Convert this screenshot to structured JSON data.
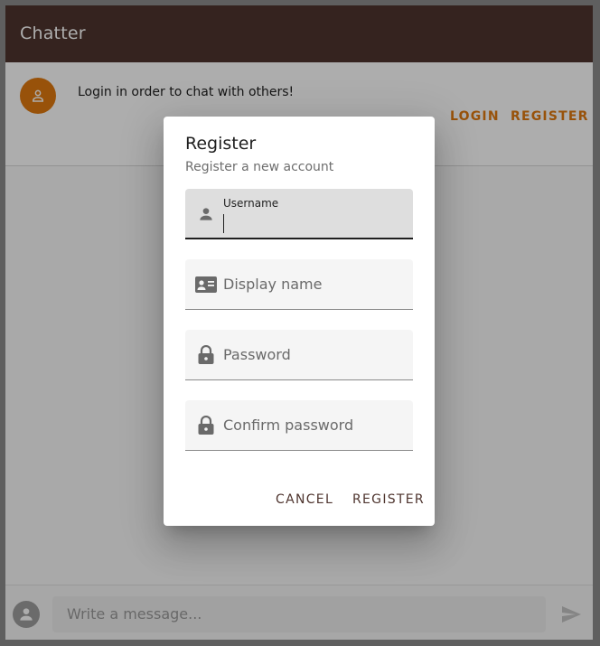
{
  "appbar": {
    "title": "Chatter"
  },
  "banner": {
    "message": "Login in order to chat with others!",
    "login_label": "LOGIN",
    "register_label": "REGISTER"
  },
  "composer": {
    "placeholder": "Write a message..."
  },
  "dialog": {
    "title": "Register",
    "subtitle": "Register a new account",
    "fields": [
      {
        "label": "Username",
        "icon": "person-icon",
        "active": true
      },
      {
        "label": "Display name",
        "icon": "id-card-icon"
      },
      {
        "label": "Password",
        "icon": "lock-icon"
      },
      {
        "label": "Confirm password",
        "icon": "lock-icon"
      }
    ],
    "cancel_label": "CANCEL",
    "register_label": "REGISTER"
  },
  "colors": {
    "appbar": "#4e342e",
    "accent": "#e07a10"
  }
}
